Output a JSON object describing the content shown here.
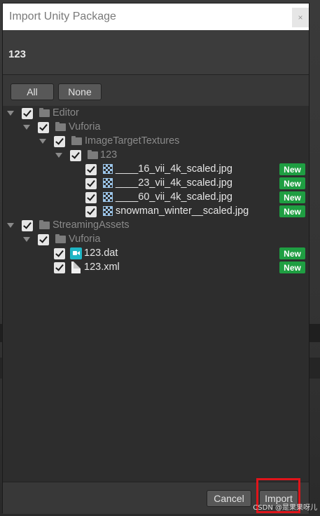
{
  "dialog": {
    "title": "Import Unity Package",
    "close_glyph": "×",
    "package_name": "123"
  },
  "toolbar": {
    "all_label": "All",
    "none_label": "None"
  },
  "tree": {
    "badge_label": "New",
    "items": [
      {
        "label": "Editor",
        "type": "folder",
        "expanded": true,
        "checked": true,
        "is_new": false
      },
      {
        "label": "Vuforia",
        "type": "folder",
        "expanded": true,
        "checked": true,
        "is_new": false
      },
      {
        "label": "ImageTargetTextures",
        "type": "folder",
        "expanded": true,
        "checked": true,
        "is_new": false
      },
      {
        "label": "123",
        "type": "folder",
        "expanded": true,
        "checked": true,
        "is_new": false
      },
      {
        "label": "____16_vii_4k_scaled.jpg",
        "type": "image",
        "checked": true,
        "is_new": true
      },
      {
        "label": "____23_vii_4k_scaled.jpg",
        "type": "image",
        "checked": true,
        "is_new": true
      },
      {
        "label": "____60_vii_4k_scaled.jpg",
        "type": "image",
        "checked": true,
        "is_new": true
      },
      {
        "label": "snowman_winter__scaled.jpg",
        "type": "image",
        "checked": true,
        "is_new": true
      },
      {
        "label": "StreamingAssets",
        "type": "folder",
        "expanded": true,
        "checked": true,
        "is_new": false
      },
      {
        "label": "Vuforia",
        "type": "folder",
        "expanded": true,
        "checked": true,
        "is_new": false
      },
      {
        "label": "123.dat",
        "type": "video",
        "checked": true,
        "is_new": true
      },
      {
        "label": "123.xml",
        "type": "document",
        "checked": true,
        "is_new": true
      }
    ]
  },
  "footer": {
    "cancel_label": "Cancel",
    "import_label": "Import"
  },
  "watermark": "CSDN @是果果呀儿",
  "colors": {
    "badge": "#1f9e42",
    "highlight": "#e0141a",
    "dialog_bg": "#383838"
  }
}
